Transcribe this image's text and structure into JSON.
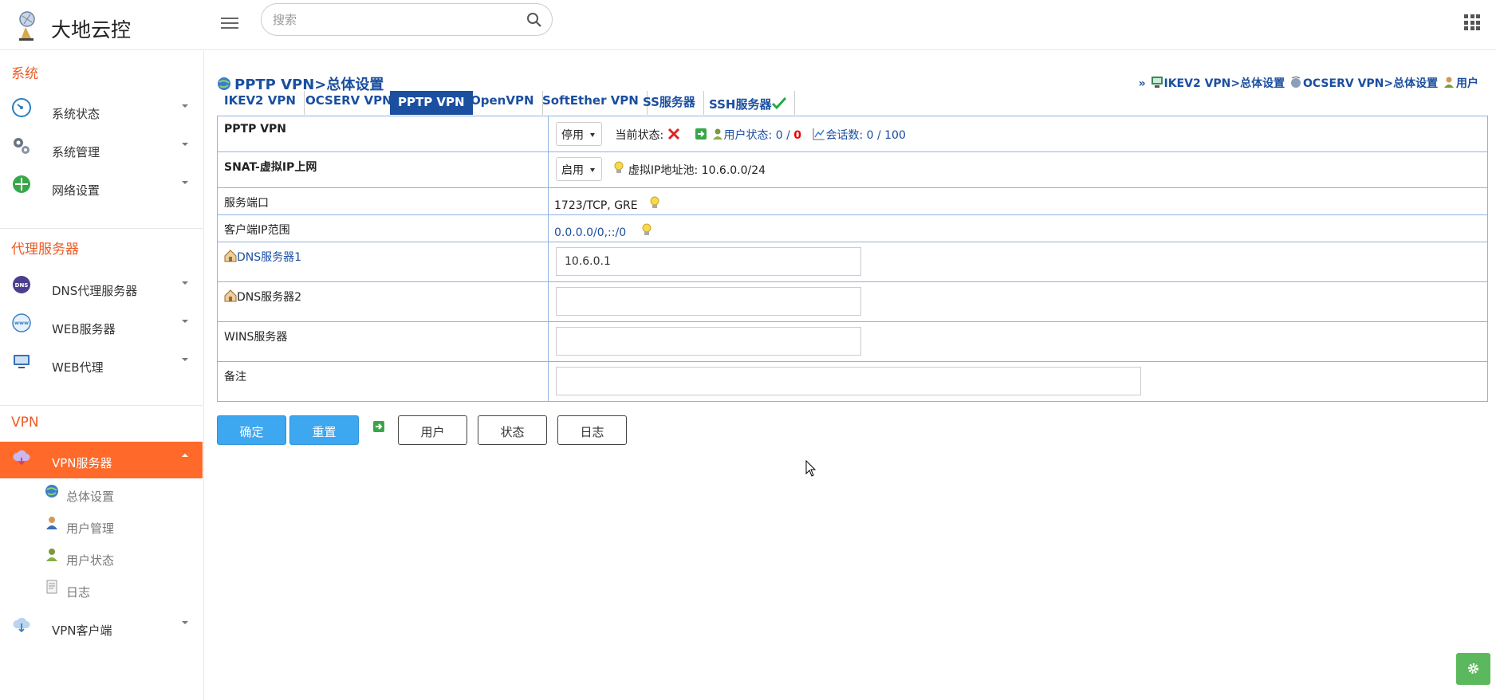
{
  "header": {
    "brand": "大地云控",
    "search_placeholder": "搜索"
  },
  "sidebar": {
    "sections": [
      {
        "title": "系统"
      },
      {
        "title": "代理服务器"
      },
      {
        "title": "VPN"
      }
    ],
    "items": [
      {
        "label": "系统状态"
      },
      {
        "label": "系统管理"
      },
      {
        "label": "网络设置"
      },
      {
        "label": "DNS代理服务器"
      },
      {
        "label": "WEB服务器"
      },
      {
        "label": "WEB代理"
      },
      {
        "label": "VPN服务器"
      },
      {
        "label": "VPN客户端"
      }
    ],
    "subitems": [
      {
        "label": "总体设置"
      },
      {
        "label": "用户管理"
      },
      {
        "label": "用户状态"
      },
      {
        "label": "日志"
      }
    ]
  },
  "main": {
    "title": "PPTP VPN>总体设置",
    "quicklinks": {
      "prefix": "»",
      "items": [
        {
          "label": "IKEV2 VPN>总体设置"
        },
        {
          "label": "OCSERV VPN>总体设置"
        },
        {
          "label": "用户"
        }
      ]
    },
    "tabs": [
      {
        "label": "IKEV2 VPN"
      },
      {
        "label": "OCSERV VPN"
      },
      {
        "label": "PPTP VPN"
      },
      {
        "label": "OpenVPN"
      },
      {
        "label": "SoftEther VPN"
      },
      {
        "label": "SS服务器"
      },
      {
        "label": "SSH服务器"
      }
    ],
    "rows": {
      "pptp": {
        "label": "PPTP VPN",
        "select": "停用",
        "status_label": "当前状态:",
        "user_status_label": "用户状态:",
        "users_a": "0",
        "users_sep": "/",
        "users_b": "0",
        "sessions_label": "会话数:",
        "sessions": "0 / 100"
      },
      "snat": {
        "label": "SNAT-虚拟IP上网",
        "select": "启用",
        "pool_label": "虚拟IP地址池:",
        "pool": "10.6.0.0/24"
      },
      "port": {
        "label": "服务端口",
        "value": "1723/TCP, GRE"
      },
      "client_range": {
        "label": "客户端IP范围",
        "value": "0.0.0.0/0,::/0"
      },
      "dns1": {
        "label": "DNS服务器1",
        "value": "10.6.0.1"
      },
      "dns2": {
        "label": "DNS服务器2",
        "value": ""
      },
      "wins": {
        "label": "WINS服务器",
        "value": ""
      },
      "remark": {
        "label": "备注",
        "value": ""
      }
    },
    "buttons": {
      "ok": "确定",
      "reset": "重置",
      "users": "用户",
      "status": "状态",
      "log": "日志"
    }
  },
  "colors": {
    "accent_orange": "#ff6a2a",
    "link_blue": "#1b4fa0",
    "button_blue": "#3da7f0",
    "table_border": "#8fb3e0",
    "settings_green": "#5cb85c"
  }
}
